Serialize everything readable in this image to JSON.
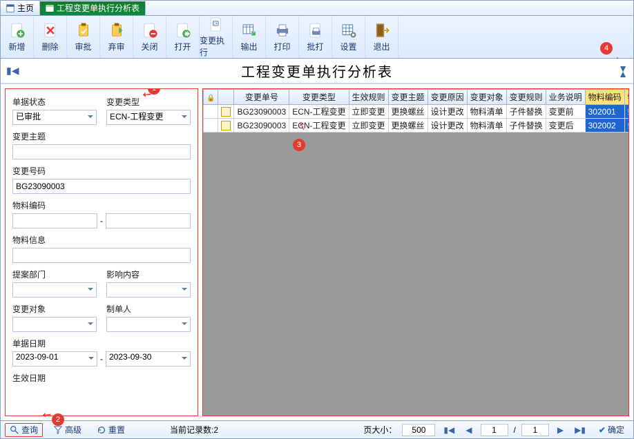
{
  "tabs": {
    "home": "主页",
    "report": "工程变更单执行分析表"
  },
  "toolbar": {
    "add": "新增",
    "delete": "删除",
    "approve": "审批",
    "abandon": "弃审",
    "close": "关闭",
    "open": "打开",
    "exec": "变更执行",
    "export": "输出",
    "print": "打印",
    "batch": "批打",
    "settings": "设置",
    "exit": "退出"
  },
  "title": "工程变更单执行分析表",
  "filter": {
    "status": {
      "label": "单据状态",
      "value": "已审批"
    },
    "chgtype": {
      "label": "变更类型",
      "value": "ECN-工程变更"
    },
    "subject": {
      "label": "变更主题",
      "value": ""
    },
    "chgno": {
      "label": "变更号码",
      "value": "BG23090003"
    },
    "matcode": {
      "label": "物料编码",
      "from": "",
      "to": ""
    },
    "matinfo": {
      "label": "物料信息",
      "value": ""
    },
    "dept": {
      "label": "提案部门",
      "value": ""
    },
    "impact": {
      "label": "影响内容",
      "value": ""
    },
    "target": {
      "label": "变更对象",
      "value": ""
    },
    "creator": {
      "label": "制单人",
      "value": ""
    },
    "docdate": {
      "label": "单据日期",
      "from": "2023-09-01",
      "to": "2023-09-30"
    },
    "effdate_label": "生效日期"
  },
  "status": {
    "query": "查询",
    "advanced": "高级",
    "reset": "重置",
    "count_label": "当前记录数:",
    "count": "2",
    "pagesize_label": "页大小：",
    "pagesize": "500",
    "page": "1",
    "total_pages": "1",
    "ok": "确定"
  },
  "grid": {
    "headers": {
      "lock": "",
      "chk": "",
      "chgno": "变更单号",
      "chgtype": "变更类型",
      "effrule": "生效规则",
      "subject": "变更主题",
      "reason": "变更原因",
      "target": "变更对象",
      "chgrule": "变更规则",
      "bizdesc": "业务说明",
      "matcode": "物料编码",
      "mat": "物"
    },
    "rows": [
      {
        "chgno": "BG23090003",
        "chgtype": "ECN-工程变更",
        "effrule": "立即变更",
        "subject": "更换螺丝",
        "reason": "设计更改",
        "target": "物料清单",
        "chgrule": "子件替换",
        "bizdesc": "变更前",
        "matcode": "302001",
        "mat": "螺"
      },
      {
        "chgno": "BG23090003",
        "chgtype": "ECN-工程变更",
        "effrule": "立即变更",
        "subject": "更换螺丝",
        "reason": "设计更改",
        "target": "物料清单",
        "chgrule": "子件替换",
        "bizdesc": "变更后",
        "matcode": "302002",
        "mat": "螺"
      }
    ]
  },
  "badges": {
    "n1": "1",
    "n2": "2",
    "n3": "3",
    "n4": "4"
  }
}
